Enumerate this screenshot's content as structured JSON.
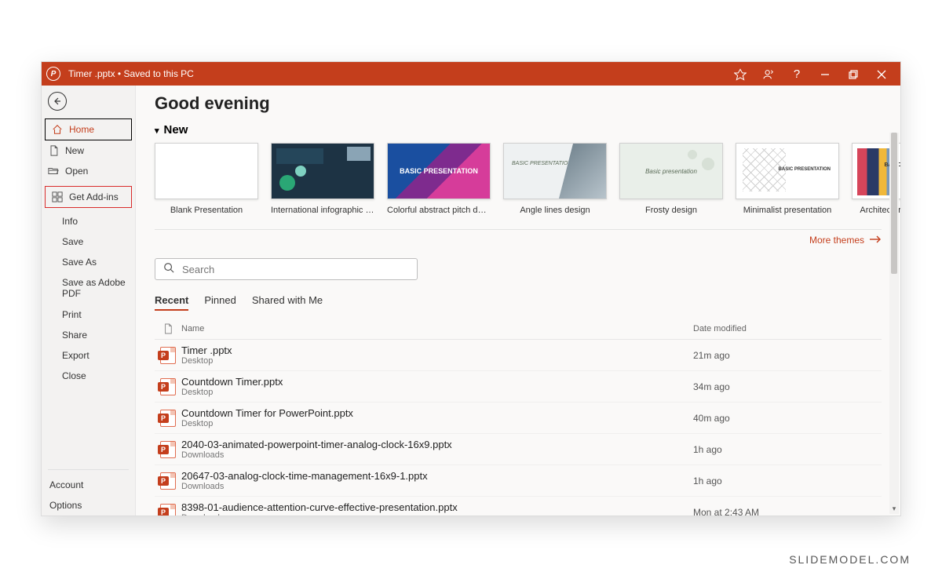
{
  "titlebar": {
    "filename": "Timer .pptx",
    "save_status": "Saved to this PC"
  },
  "sidebar": {
    "home": "Home",
    "new": "New",
    "open": "Open",
    "get_addins": "Get Add-ins",
    "info": "Info",
    "save": "Save",
    "save_as": "Save As",
    "save_as_adobe": "Save as Adobe PDF",
    "print": "Print",
    "share": "Share",
    "export": "Export",
    "close": "Close",
    "account": "Account",
    "options": "Options"
  },
  "main": {
    "greeting": "Good evening",
    "new_label": "New",
    "more_themes": "More themes",
    "templates": [
      {
        "label": "Blank Presentation"
      },
      {
        "label": "International infographic re..."
      },
      {
        "label": "Colorful abstract pitch deck"
      },
      {
        "label": "Angle lines design"
      },
      {
        "label": "Frosty design"
      },
      {
        "label": "Minimalist presentation"
      },
      {
        "label": "Architecture pitch deck"
      }
    ],
    "thumb_text": {
      "color": "BASIC PRESENTATION",
      "angle": "BASIC PRESENTATION",
      "frosty": "Basic presentation",
      "min": "BASIC PRESENTATION",
      "arch": "BASIC PRESENTATION"
    },
    "search_placeholder": "Search",
    "tabs": {
      "recent": "Recent",
      "pinned": "Pinned",
      "shared": "Shared with Me"
    },
    "columns": {
      "name": "Name",
      "modified": "Date modified"
    },
    "files": [
      {
        "name": "Timer .pptx",
        "location": "Desktop",
        "modified": "21m ago"
      },
      {
        "name": "Countdown Timer.pptx",
        "location": "Desktop",
        "modified": "34m ago"
      },
      {
        "name": "Countdown Timer for PowerPoint.pptx",
        "location": "Desktop",
        "modified": "40m ago"
      },
      {
        "name": "2040-03-animated-powerpoint-timer-analog-clock-16x9.pptx",
        "location": "Downloads",
        "modified": "1h ago"
      },
      {
        "name": "20647-03-analog-clock-time-management-16x9-1.pptx",
        "location": "Downloads",
        "modified": "1h ago"
      },
      {
        "name": "8398-01-audience-attention-curve-effective-presentation.pptx",
        "location": "Downloads",
        "modified": "Mon at 2:43 AM"
      }
    ]
  },
  "watermark": "SLIDEMODEL.COM"
}
